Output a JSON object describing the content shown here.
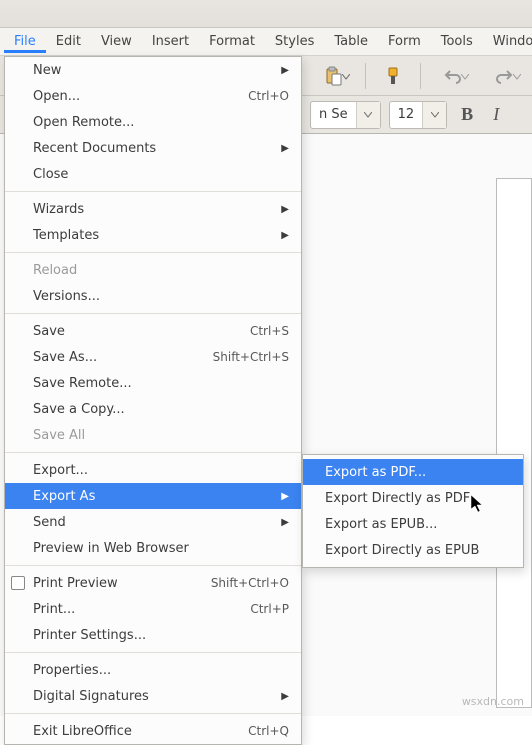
{
  "menubar": {
    "items": [
      "File",
      "Edit",
      "View",
      "Insert",
      "Format",
      "Styles",
      "Table",
      "Form",
      "Tools",
      "Window"
    ],
    "active_index": 0
  },
  "formatbar": {
    "font_fragment": "n Se",
    "font_size": "12",
    "bold": "B",
    "italic": "I"
  },
  "file_menu": [
    {
      "type": "item",
      "label": "New",
      "accel": "",
      "submenu": true
    },
    {
      "type": "item",
      "label": "Open...",
      "accel": "Ctrl+O"
    },
    {
      "type": "item",
      "label": "Open Remote..."
    },
    {
      "type": "item",
      "label": "Recent Documents",
      "submenu": true
    },
    {
      "type": "item",
      "label": "Close"
    },
    {
      "type": "sep"
    },
    {
      "type": "item",
      "label": "Wizards",
      "submenu": true
    },
    {
      "type": "item",
      "label": "Templates",
      "submenu": true
    },
    {
      "type": "sep"
    },
    {
      "type": "item",
      "label": "Reload",
      "disabled": true
    },
    {
      "type": "item",
      "label": "Versions..."
    },
    {
      "type": "sep"
    },
    {
      "type": "item",
      "label": "Save",
      "accel": "Ctrl+S"
    },
    {
      "type": "item",
      "label": "Save As...",
      "accel": "Shift+Ctrl+S"
    },
    {
      "type": "item",
      "label": "Save Remote..."
    },
    {
      "type": "item",
      "label": "Save a Copy..."
    },
    {
      "type": "item",
      "label": "Save All",
      "disabled": true
    },
    {
      "type": "sep"
    },
    {
      "type": "item",
      "label": "Export..."
    },
    {
      "type": "item",
      "label": "Export As",
      "submenu": true,
      "highlight": true
    },
    {
      "type": "item",
      "label": "Send",
      "submenu": true
    },
    {
      "type": "item",
      "label": "Preview in Web Browser"
    },
    {
      "type": "sep"
    },
    {
      "type": "item",
      "label": "Print Preview",
      "accel": "Shift+Ctrl+O",
      "check": true
    },
    {
      "type": "item",
      "label": "Print...",
      "accel": "Ctrl+P"
    },
    {
      "type": "item",
      "label": "Printer Settings..."
    },
    {
      "type": "sep"
    },
    {
      "type": "item",
      "label": "Properties..."
    },
    {
      "type": "item",
      "label": "Digital Signatures",
      "submenu": true
    },
    {
      "type": "sep"
    },
    {
      "type": "item",
      "label": "Exit LibreOffice",
      "accel": "Ctrl+Q"
    }
  ],
  "export_submenu": [
    {
      "label": "Export as PDF...",
      "highlight": true
    },
    {
      "label": "Export Directly as PDF"
    },
    {
      "label": "Export as EPUB..."
    },
    {
      "label": "Export Directly as EPUB"
    }
  ],
  "watermark": "wsxdn.com"
}
